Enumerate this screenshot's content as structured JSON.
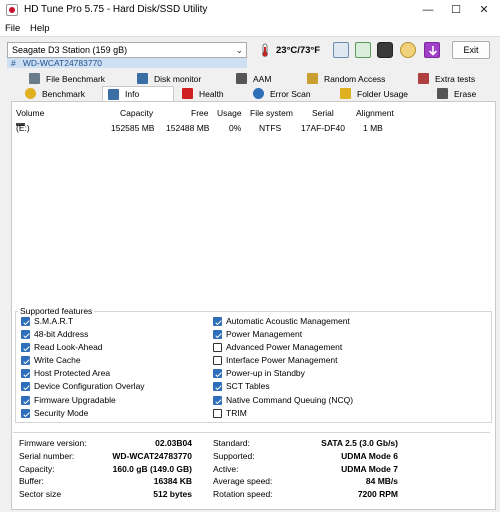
{
  "window": {
    "title": "HD Tune Pro 5.75 - Hard Disk/SSD Utility"
  },
  "menu": {
    "file": "File",
    "help": "Help"
  },
  "toolbar": {
    "drive": "Seagate D3 Station (159 gB)",
    "serial_prefix": "#",
    "serial": "WD-WCAT24783770",
    "temperature": "23°C/73°F",
    "exit": "Exit"
  },
  "tabs": {
    "row1": [
      {
        "label": "File Benchmark",
        "icon": "file-benchmark-icon",
        "color": "#6a7b8c"
      },
      {
        "label": "Disk monitor",
        "icon": "disk-monitor-icon",
        "color": "#3b6ea5"
      },
      {
        "label": "AAM",
        "icon": "speaker-icon",
        "color": "#555555"
      },
      {
        "label": "Random Access",
        "icon": "random-access-icon",
        "color": "#c8a030"
      },
      {
        "label": "Extra tests",
        "icon": "extra-tests-icon",
        "color": "#b04040"
      }
    ],
    "row2": [
      {
        "label": "Benchmark",
        "icon": "benchmark-icon",
        "color": "#e0b020"
      },
      {
        "label": "Info",
        "icon": "info-icon",
        "color": "#3b6ea5"
      },
      {
        "label": "Health",
        "icon": "health-icon",
        "color": "#d02020"
      },
      {
        "label": "Error Scan",
        "icon": "magnifier-icon",
        "color": "#2f6fba"
      },
      {
        "label": "Folder Usage",
        "icon": "folder-icon",
        "color": "#e0b020"
      },
      {
        "label": "Erase",
        "icon": "trash-icon",
        "color": "#555555"
      }
    ]
  },
  "volumes": {
    "headers": [
      "Volume",
      "Capacity",
      "Free",
      "Usage",
      "File system",
      "Serial",
      "Alignment"
    ],
    "rows": [
      [
        "(E:)",
        "152585 MB",
        "152488 MB",
        "0%",
        "NTFS",
        "17AF-DF40",
        "1 MB"
      ]
    ]
  },
  "features": {
    "title": "Supported features",
    "left": [
      {
        "label": "S.M.A.R.T",
        "checked": true
      },
      {
        "label": "48-bit Address",
        "checked": true
      },
      {
        "label": "Read Look-Ahead",
        "checked": true
      },
      {
        "label": "Write Cache",
        "checked": true
      },
      {
        "label": "Host Protected Area",
        "checked": true
      },
      {
        "label": "Device Configuration Overlay",
        "checked": true
      },
      {
        "label": "Firmware Upgradable",
        "checked": true
      },
      {
        "label": "Security Mode",
        "checked": true
      }
    ],
    "right": [
      {
        "label": "Automatic Acoustic Management",
        "checked": true
      },
      {
        "label": "Power Management",
        "checked": true
      },
      {
        "label": "Advanced Power Management",
        "checked": false
      },
      {
        "label": "Interface Power Management",
        "checked": false
      },
      {
        "label": "Power-up in Standby",
        "checked": true
      },
      {
        "label": "SCT Tables",
        "checked": true
      },
      {
        "label": "Native Command Queuing (NCQ)",
        "checked": true
      },
      {
        "label": "TRIM",
        "checked": false
      }
    ]
  },
  "info": {
    "left": [
      {
        "label": "Firmware version:",
        "value": "02.03B04"
      },
      {
        "label": "Serial number:",
        "value": "WD-WCAT24783770"
      },
      {
        "label": "Capacity:",
        "value": "160.0 gB (149.0 GB)"
      },
      {
        "label": "Buffer:",
        "value": "16384 KB"
      },
      {
        "label": "Sector size",
        "value": "512 bytes"
      }
    ],
    "right": [
      {
        "label": "Standard:",
        "value": "SATA 2.5 (3.0 Gb/s)"
      },
      {
        "label": "Supported:",
        "value": "UDMA Mode 6"
      },
      {
        "label": "Active:",
        "value": "UDMA Mode 7"
      },
      {
        "label": "Average speed:",
        "value": "84 MB/s"
      },
      {
        "label": "Rotation speed:",
        "value": "7200 RPM"
      }
    ]
  }
}
